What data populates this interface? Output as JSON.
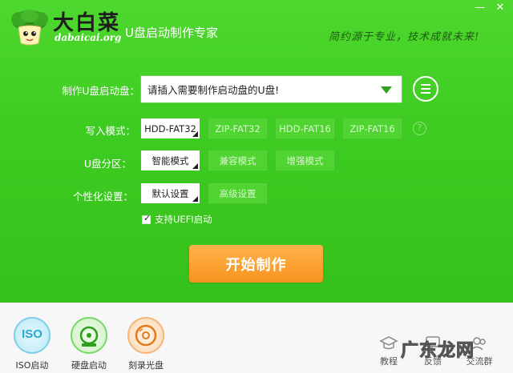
{
  "header": {
    "brand_cn": "大白菜",
    "brand_en": "dabaicai.org",
    "app_title": "U盘启动制作专家",
    "slogan": "简约源于专业，技术成就未来!"
  },
  "window_controls": {
    "minimize": "—",
    "close": "✕"
  },
  "form": {
    "udisk_label": "制作U盘启动盘：",
    "udisk_value": "请插入需要制作启动盘的U盘!",
    "write_mode_label": "写入模式：",
    "write_modes": [
      "HDD-FAT32",
      "ZIP-FAT32",
      "HDD-FAT16",
      "ZIP-FAT16"
    ],
    "partition_label": "U盘分区：",
    "partitions": [
      "智能模式",
      "兼容模式",
      "增强模式"
    ],
    "personal_label": "个性化设置：",
    "personal": [
      "默认设置",
      "高级设置"
    ],
    "uefi_label": "支持UEFI启动",
    "uefi_checked": true,
    "help": "?"
  },
  "start_button": "开始制作",
  "bottom_tools": [
    {
      "label": "ISO启动",
      "icon": "iso-icon"
    },
    {
      "label": "硬盘启动",
      "icon": "harddisk-boot-icon"
    },
    {
      "label": "刻录光盘",
      "icon": "disc-burn-icon"
    }
  ],
  "small_tools": [
    {
      "label": "教程",
      "icon": "tutorial-icon"
    },
    {
      "label": "反馈",
      "icon": "feedback-icon"
    },
    {
      "label": "交流群",
      "icon": "chat-group-icon"
    }
  ],
  "iso_text": "ISO",
  "watermark": "广东龙网",
  "colors": {
    "green_bg": "#3fcc22",
    "start_orange": "#f79420"
  }
}
